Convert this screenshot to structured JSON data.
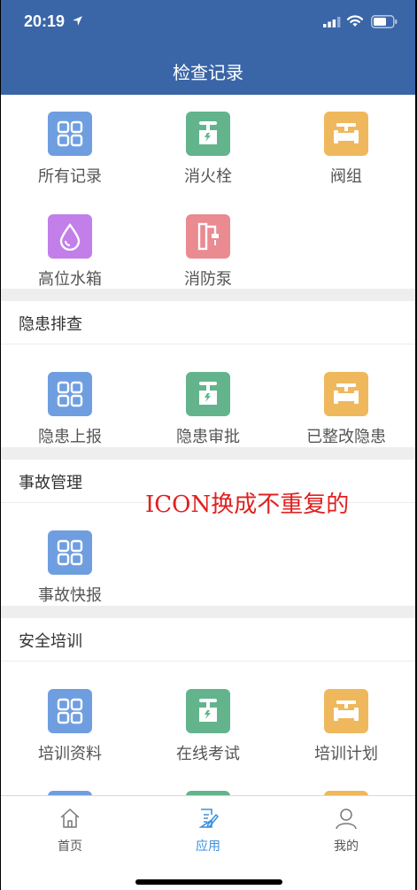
{
  "status_bar": {
    "time": "20:19"
  },
  "header": {
    "title": "检查记录"
  },
  "inspection": {
    "items": [
      {
        "label": "所有记录",
        "icon": "grid-icon",
        "color": "#6f9ee0"
      },
      {
        "label": "消火栓",
        "icon": "hydrant-icon",
        "color": "#63b48c"
      },
      {
        "label": "阀组",
        "icon": "valve-icon",
        "color": "#efb85d"
      },
      {
        "label": "高位水箱",
        "icon": "water-drop-icon",
        "color": "#c27fe9"
      },
      {
        "label": "消防泵",
        "icon": "pump-icon",
        "color": "#ea8a91"
      }
    ]
  },
  "hazard": {
    "title": "隐患排查",
    "items": [
      {
        "label": "隐患上报",
        "icon": "grid-icon"
      },
      {
        "label": "隐患审批",
        "icon": "hydrant-icon"
      },
      {
        "label": "已整改隐患",
        "icon": "valve-icon"
      }
    ]
  },
  "accident": {
    "title": "事故管理",
    "items": [
      {
        "label": "事故快报",
        "icon": "grid-icon"
      }
    ]
  },
  "annotation": "ICON换成不重复的",
  "training": {
    "title": "安全培训",
    "items": [
      {
        "label": "培训资料",
        "icon": "grid-icon"
      },
      {
        "label": "在线考试",
        "icon": "hydrant-icon"
      },
      {
        "label": "培训计划",
        "icon": "valve-icon"
      }
    ]
  },
  "tabbar": {
    "tabs": [
      {
        "label": "首页",
        "icon": "home-icon",
        "active": false
      },
      {
        "label": "应用",
        "icon": "edit-document-icon",
        "active": true
      },
      {
        "label": "我的",
        "icon": "user-icon",
        "active": false
      }
    ],
    "active_color": "#3b8fde"
  }
}
